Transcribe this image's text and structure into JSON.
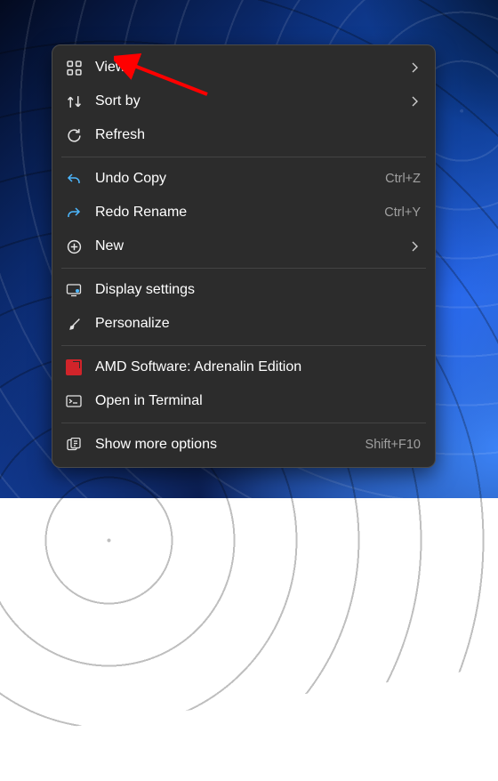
{
  "annotation": {
    "arrow_color": "#ff0000"
  },
  "menu": {
    "groups": [
      [
        {
          "icon": "grid-icon",
          "label": "View",
          "submenu": true
        },
        {
          "icon": "sort-icon",
          "label": "Sort by",
          "submenu": true
        },
        {
          "icon": "refresh-icon",
          "label": "Refresh"
        }
      ],
      [
        {
          "icon": "undo-icon",
          "label": "Undo Copy",
          "shortcut": "Ctrl+Z"
        },
        {
          "icon": "redo-icon",
          "label": "Redo Rename",
          "shortcut": "Ctrl+Y"
        },
        {
          "icon": "plus-circle-icon",
          "label": "New",
          "submenu": true
        }
      ],
      [
        {
          "icon": "display-icon",
          "label": "Display settings"
        },
        {
          "icon": "brush-icon",
          "label": "Personalize"
        }
      ],
      [
        {
          "icon": "amd-icon",
          "label": "AMD Software: Adrenalin Edition"
        },
        {
          "icon": "terminal-icon",
          "label": "Open in Terminal"
        }
      ],
      [
        {
          "icon": "more-icon",
          "label": "Show more options",
          "shortcut": "Shift+F10"
        }
      ]
    ]
  }
}
